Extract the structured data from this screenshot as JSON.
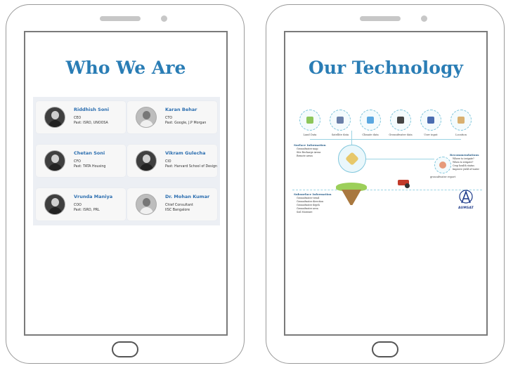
{
  "left_tablet": {
    "title": "Who We Are",
    "team": [
      {
        "name": "Riddhish Soni",
        "role": "CEO",
        "past": "Past: ISRO, UNOOSA"
      },
      {
        "name": "Karan Behar",
        "role": "CTO",
        "past": "Past: Google, J.P Morgan"
      },
      {
        "name": "Chetan Soni",
        "role": "CFO",
        "past": "Past: TATA Housing"
      },
      {
        "name": "Vikram Gulecha",
        "role": "CIO",
        "past": "Past: Harvard School of Design"
      },
      {
        "name": "Vrunda Maniya",
        "role": "COO",
        "past": "Past: ISRO, PRL"
      },
      {
        "name": "Dr. Mohan Kumar",
        "role": "Chief Consultant",
        "past": "IISC Bangalore"
      }
    ]
  },
  "right_tablet": {
    "title": "Our Technology",
    "icons": [
      "Land Data",
      "Satellite data",
      "Climate data",
      "Groundwater data",
      "User input",
      "Location"
    ],
    "surface": {
      "heading": "Surface Information",
      "items": [
        "Groundwater map",
        "Site Recharge Areas",
        "Remote areas"
      ]
    },
    "subsurface": {
      "heading": "Subsurface Information",
      "items": [
        "Groundwater trend",
        "Groundwater direction",
        "Groundwater depth",
        "Groundwater area",
        "Soil Moisture"
      ]
    },
    "recommendations": {
      "heading": "Recommendations",
      "items": [
        "Where to irrigate?",
        "When to irrigate?",
        "Crop health status",
        "Improve yield of water"
      ]
    },
    "groundwater_report": "groundwater report",
    "logo_text": "AUMSAT"
  }
}
